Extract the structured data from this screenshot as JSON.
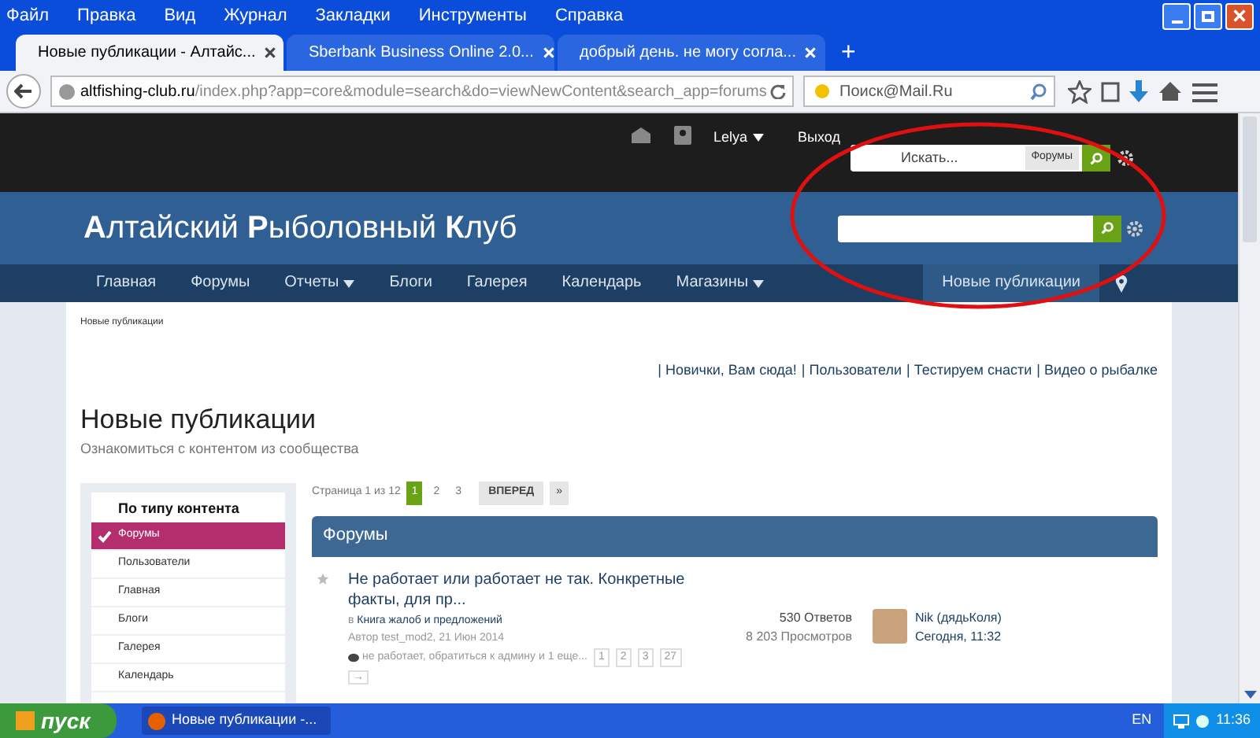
{
  "menu_bar": [
    "Файл",
    "Правка",
    "Вид",
    "Журнал",
    "Закладки",
    "Инструменты",
    "Справка"
  ],
  "tabs": [
    {
      "label": "Новые публикации - Алтайс...",
      "selected": true
    },
    {
      "label": "Sberbank Business Online 2.0...",
      "selected": false
    },
    {
      "label": "добрый день. не могу согла...",
      "selected": false
    }
  ],
  "new_tab": "+",
  "address": {
    "domain": "altfishing-club.ru",
    "path": "/index.php?app=core&module=search&do=viewNewContent&search_app=forums"
  },
  "browser_search": {
    "placeholder": "Поиск@Mail.Ru"
  },
  "user_bar": {
    "user": "Lelya",
    "logout": "Выход",
    "search_placeholder": "Искать...",
    "scope": "Форумы"
  },
  "site_title": "**А**лтайский **Р**ыболовный **К**луб",
  "nav": [
    {
      "label": "Главная",
      "dropdown": false,
      "selected": false
    },
    {
      "label": "Форумы",
      "dropdown": false,
      "selected": false
    },
    {
      "label": "Отчеты",
      "dropdown": true,
      "selected": false
    },
    {
      "label": "Блоги",
      "dropdown": false,
      "selected": false
    },
    {
      "label": "Галерея",
      "dropdown": false,
      "selected": false
    },
    {
      "label": "Календарь",
      "dropdown": false,
      "selected": false
    },
    {
      "label": "Магазины",
      "dropdown": true,
      "selected": false
    }
  ],
  "nav_right": {
    "label": "Новые публикации",
    "selected": true
  },
  "breadcrumb": "Новые публикации",
  "quick_links": [
    "| Новички, Вам сюда!",
    "| Пользователи",
    "| Тестируем снасти",
    "| Видео о рыбалке"
  ],
  "page_title": "Новые публикации",
  "page_subtitle": "Ознакомиться с контентом из сообщества",
  "sidebar": {
    "title": "По типу контента",
    "items": [
      {
        "label": "Форумы",
        "selected": true
      },
      {
        "label": "Пользователи",
        "selected": false
      },
      {
        "label": "Главная",
        "selected": false
      },
      {
        "label": "Блоги",
        "selected": false
      },
      {
        "label": "Галерея",
        "selected": false
      },
      {
        "label": "Календарь",
        "selected": false
      }
    ]
  },
  "pagination": {
    "label": "Страница 1 из 12",
    "pages": [
      {
        "label": "1",
        "selected": true
      },
      {
        "label": "2",
        "selected": false
      },
      {
        "label": "3",
        "selected": false
      }
    ],
    "next": "ВПЕРЕД",
    "last": "»"
  },
  "section_title": "Форумы",
  "topics": [
    {
      "title": "Не работает или работает не так. Конкретные факты, для пр...",
      "forum_prefix": "в",
      "forum": "Книга жалоб и предложений",
      "author_line": "Автор test_mod2, 21 Июн 2014",
      "tags": "не работает, обратиться к админу и 1 еще...",
      "pages": [
        "1",
        "2",
        "3",
        "27"
      ],
      "last_page": "→",
      "replies": "530 Ответов",
      "views": "8 203 Просмотров",
      "last_user": "Nik (дядьКоля)",
      "last_time": "Сегодня, 11:32"
    }
  ],
  "taskbar": {
    "start": "пуск",
    "window": "Новые публикации -...",
    "lang": "EN",
    "clock": "11:36"
  }
}
